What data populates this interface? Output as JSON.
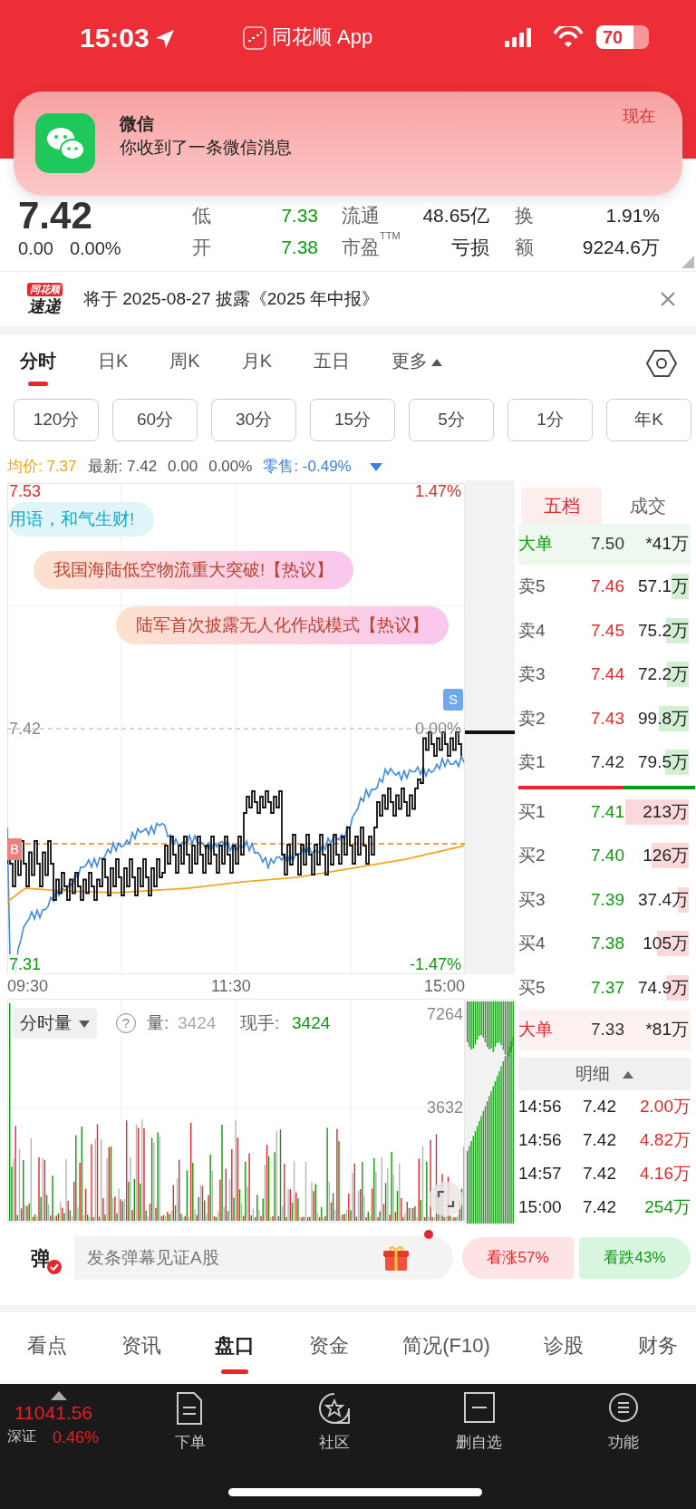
{
  "status_bar": {
    "time": "15:03",
    "app_label": "同花顺 App",
    "battery": "70"
  },
  "notification": {
    "app": "微信",
    "message": "你收到了一条微信消息",
    "time": "现在"
  },
  "quote": {
    "price": "7.42",
    "change": "0.00",
    "change_pct": "0.00%",
    "stats": [
      [
        {
          "label": "低",
          "value": "7.33",
          "color": "#0e9a0e"
        },
        {
          "label": "流通",
          "value": "48.65亿"
        },
        {
          "label": "换",
          "value": "1.91%"
        }
      ],
      [
        {
          "label": "开",
          "value": "7.38",
          "color": "#0e9a0e"
        },
        {
          "label": "市盈$^{TTM}$",
          "value": "亏损"
        },
        {
          "label": "额",
          "value": "9224.6万"
        }
      ]
    ]
  },
  "announcement": {
    "logo_top": "同花顺",
    "logo_bottom": "速递",
    "text": "将于 2025-08-27 披露《2025 年中报》"
  },
  "chart_tabs": [
    {
      "label": "分时",
      "selected": true
    },
    {
      "label": "日K",
      "selected": false
    },
    {
      "label": "周K",
      "selected": false
    },
    {
      "label": "月K",
      "selected": false
    },
    {
      "label": "五日",
      "selected": false
    },
    {
      "label": "更多",
      "selected": false,
      "has_menu": true
    }
  ],
  "periods": [
    "120分",
    "60分",
    "30分",
    "15分",
    "5分",
    "1分",
    "年K"
  ],
  "info": [
    {
      "text": "均价: 7.37",
      "color": "#f2a20c"
    },
    {
      "text": "最新: 7.42",
      "color": "#555555"
    },
    {
      "text": "0.00",
      "color": "#555555"
    },
    {
      "text": "0.00%",
      "color": "#555555"
    },
    {
      "text": "零售: -0.49%",
      "color": "#3b82e0",
      "dropdown": true
    }
  ],
  "price_chart": {
    "high": "7.53",
    "high_pct": "1.47%",
    "last": "7.42",
    "last_pct": "0.00%",
    "low": "7.31",
    "low_pct": "-1.47%",
    "times": [
      "09:30",
      "11:30",
      "15:00"
    ],
    "buy_marker": "B",
    "sell_marker": "S"
  },
  "bullets": [
    {
      "text": "用语，和气生财!",
      "kind": "tip"
    },
    {
      "text": "我国海陆低空物流重大突破!【热议】",
      "kind": "hot"
    },
    {
      "text": "陆军首次披露无人化作战模式【热议】",
      "kind": "hot"
    }
  ],
  "order_book": {
    "tabs": [
      {
        "label": "五档",
        "selected": true
      },
      {
        "label": "成交",
        "selected": false
      }
    ],
    "rows": [
      {
        "kind": "big",
        "label": "大单",
        "price": "7.50",
        "volume": "*41万",
        "color": "#0e9a0e"
      },
      {
        "kind": "sell",
        "label": "卖5",
        "price": "7.46",
        "volume": "57.1万",
        "color": "#e8262b"
      },
      {
        "kind": "sell",
        "label": "卖4",
        "price": "7.45",
        "volume": "75.2万",
        "color": "#e8262b"
      },
      {
        "kind": "sell",
        "label": "卖3",
        "price": "7.44",
        "volume": "72.2万",
        "color": "#e8262b"
      },
      {
        "kind": "sell",
        "label": "卖2",
        "price": "7.43",
        "volume": "99.8万",
        "color": "#e8262b"
      },
      {
        "kind": "sell",
        "label": "卖1",
        "price": "7.42",
        "volume": "79.5万",
        "color": "#333333"
      },
      {
        "kind": "buy",
        "label": "买1",
        "price": "7.41",
        "volume": "213万",
        "color": "#0e9a0e"
      },
      {
        "kind": "buy",
        "label": "买2",
        "price": "7.40",
        "volume": "126万",
        "color": "#0e9a0e"
      },
      {
        "kind": "buy",
        "label": "买3",
        "price": "7.39",
        "volume": "37.4万",
        "color": "#0e9a0e"
      },
      {
        "kind": "buy",
        "label": "买4",
        "price": "7.38",
        "volume": "105万",
        "color": "#0e9a0e"
      },
      {
        "kind": "buy",
        "label": "买5",
        "price": "7.37",
        "volume": "74.9万",
        "color": "#0e9a0e"
      },
      {
        "kind": "big",
        "label": "大单",
        "price": "7.33",
        "volume": "*81万",
        "color": "#e8262b"
      }
    ]
  },
  "detail": {
    "title": "明细",
    "trades": [
      {
        "time": "14:56",
        "price": "7.42",
        "amount": "2.00万",
        "color": "#e8262b"
      },
      {
        "time": "14:56",
        "price": "7.42",
        "amount": "4.82万",
        "color": "#e8262b"
      },
      {
        "time": "14:57",
        "price": "7.42",
        "amount": "4.16万",
        "color": "#e8262b"
      },
      {
        "time": "15:00",
        "price": "7.42",
        "amount": "254万",
        "color": "#0e9a0e"
      }
    ]
  },
  "volume_chart": {
    "selector": "分时量",
    "help": "?",
    "volume_label": "量:",
    "volume": "3424",
    "hand_label": "现手:",
    "hand": "3424",
    "max": "7264",
    "mid": "3632"
  },
  "danmaku": {
    "badge": "弹",
    "placeholder": "发条弹幕见证A股"
  },
  "sentiment": [
    {
      "label": "看涨57%",
      "kind": "up"
    },
    {
      "label": "看跌43%",
      "kind": "down"
    }
  ],
  "bottom_tabs": [
    {
      "label": "看点",
      "selected": false
    },
    {
      "label": "资讯",
      "selected": false
    },
    {
      "label": "盘口",
      "selected": true
    },
    {
      "label": "资金",
      "selected": false
    },
    {
      "label": "简况(F10)",
      "selected": false
    },
    {
      "label": "诊股",
      "selected": false
    },
    {
      "label": "财务",
      "selected": false
    }
  ],
  "index_ticker": {
    "value": "11041.56",
    "name": "深证",
    "change": "0.46%"
  },
  "toolbar": [
    {
      "label": "下单",
      "kind": "order"
    },
    {
      "label": "社区",
      "kind": "community"
    },
    {
      "label": "删自选",
      "kind": "remove"
    },
    {
      "label": "功能",
      "kind": "menu"
    }
  ]
}
